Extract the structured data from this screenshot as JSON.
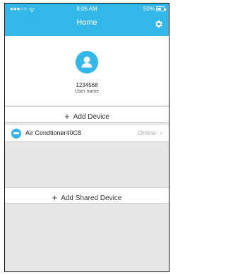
{
  "status_bar": {
    "signal": "●●●○○",
    "wifi": "ᯤ",
    "time": "8:06 AM",
    "battery": "50%"
  },
  "header": {
    "title": "Home",
    "settings_icon": "gear-icon"
  },
  "profile": {
    "user_id": "1234568",
    "user_name": "User name",
    "avatar_icon": "user-icon"
  },
  "actions": {
    "add_device": "Add Device",
    "add_shared_device": "Add Shared Device",
    "plus_symbol": "+"
  },
  "devices": [
    {
      "name": "Air Condtioner40C8",
      "status": "Online",
      "icon": "air-conditioner-icon"
    }
  ],
  "colors": {
    "accent": "#33b6e8",
    "background": "#e6e6e6"
  }
}
